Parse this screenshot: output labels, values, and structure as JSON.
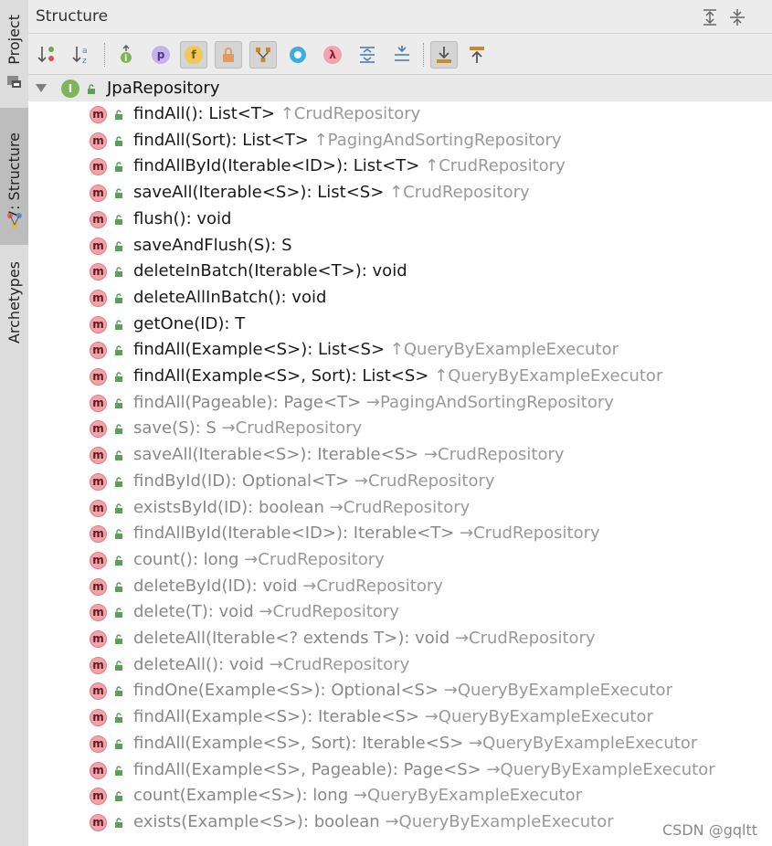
{
  "left_strip": {
    "tabs": [
      {
        "label": "Project"
      },
      {
        "label": "7: Structure"
      },
      {
        "label": "Archetypes"
      }
    ]
  },
  "panel": {
    "title": "Structure",
    "title_icons": [
      "expand-all-icon",
      "collapse-all-icon"
    ],
    "toolbar": [
      {
        "name": "sort-by-visibility-icon",
        "glyph": "↓",
        "color": "#c0392b"
      },
      {
        "name": "sort-alphabetically-icon",
        "glyph": "↓",
        "color": "#5b7ea8"
      },
      {
        "name": "show-inherited-icon",
        "glyph": "i",
        "color": "#6aa84f"
      },
      {
        "name": "show-properties-icon",
        "glyph": "p",
        "color": "#a78bd6"
      },
      {
        "name": "show-fields-icon",
        "glyph": "f",
        "color": "#e8b23a",
        "pressed": true
      },
      {
        "name": "show-non-public-icon",
        "glyph": "🔒",
        "color": "#e08a3c",
        "pressed": true
      },
      {
        "name": "show-hierarchy-icon",
        "glyph": "Y",
        "color": "#c98a2b",
        "pressed": true
      },
      {
        "name": "show-anonymous-icon",
        "glyph": "○",
        "color": "#3aaee0"
      },
      {
        "name": "show-lambdas-icon",
        "glyph": "λ",
        "color": "#e15a77"
      },
      {
        "name": "expand-icon",
        "glyph": "⇕",
        "color": "#5b8bb0"
      },
      {
        "name": "collapse-icon",
        "glyph": "⇳",
        "color": "#5b8bb0"
      },
      {
        "name": "autoscroll-to-source-icon",
        "glyph": "↓",
        "color": "#c98a2b",
        "pressed": true
      },
      {
        "name": "autoscroll-from-source-icon",
        "glyph": "↑",
        "color": "#c98a2b"
      }
    ]
  },
  "tree": {
    "root": {
      "label": "JpaRepository",
      "icon_letter": "I"
    },
    "method_icon_letter": "m",
    "items": [
      {
        "sig": "findAll(): List<T>",
        "inh": "↑CrudRepository",
        "dim": false
      },
      {
        "sig": "findAll(Sort): List<T>",
        "inh": "↑PagingAndSortingRepository",
        "dim": false
      },
      {
        "sig": "findAllById(Iterable<ID>): List<T>",
        "inh": "↑CrudRepository",
        "dim": false
      },
      {
        "sig": "saveAll(Iterable<S>): List<S>",
        "inh": "↑CrudRepository",
        "dim": false
      },
      {
        "sig": "flush(): void",
        "inh": "",
        "dim": false
      },
      {
        "sig": "saveAndFlush(S): S",
        "inh": "",
        "dim": false
      },
      {
        "sig": "deleteInBatch(Iterable<T>): void",
        "inh": "",
        "dim": false
      },
      {
        "sig": "deleteAllInBatch(): void",
        "inh": "",
        "dim": false
      },
      {
        "sig": "getOne(ID): T",
        "inh": "",
        "dim": false
      },
      {
        "sig": "findAll(Example<S>): List<S>",
        "inh": "↑QueryByExampleExecutor",
        "dim": false
      },
      {
        "sig": "findAll(Example<S>, Sort): List<S>",
        "inh": "↑QueryByExampleExecutor",
        "dim": false
      },
      {
        "sig": "findAll(Pageable): Page<T>",
        "inh": "→PagingAndSortingRepository",
        "dim": true
      },
      {
        "sig": "save(S): S",
        "inh": "→CrudRepository",
        "dim": true
      },
      {
        "sig": "saveAll(Iterable<S>): Iterable<S>",
        "inh": "→CrudRepository",
        "dim": true
      },
      {
        "sig": "findById(ID): Optional<T>",
        "inh": "→CrudRepository",
        "dim": true
      },
      {
        "sig": "existsById(ID): boolean",
        "inh": "→CrudRepository",
        "dim": true
      },
      {
        "sig": "findAllById(Iterable<ID>): Iterable<T>",
        "inh": "→CrudRepository",
        "dim": true
      },
      {
        "sig": "count(): long",
        "inh": "→CrudRepository",
        "dim": true
      },
      {
        "sig": "deleteById(ID): void",
        "inh": "→CrudRepository",
        "dim": true
      },
      {
        "sig": "delete(T): void",
        "inh": "→CrudRepository",
        "dim": true
      },
      {
        "sig": "deleteAll(Iterable<? extends T>): void",
        "inh": "→CrudRepository",
        "dim": true
      },
      {
        "sig": "deleteAll(): void",
        "inh": "→CrudRepository",
        "dim": true
      },
      {
        "sig": "findOne(Example<S>): Optional<S>",
        "inh": "→QueryByExampleExecutor",
        "dim": true
      },
      {
        "sig": "findAll(Example<S>): Iterable<S>",
        "inh": "→QueryByExampleExecutor",
        "dim": true
      },
      {
        "sig": "findAll(Example<S>, Sort): Iterable<S>",
        "inh": "→QueryByExampleExecutor",
        "dim": true
      },
      {
        "sig": "findAll(Example<S>, Pageable): Page<S>",
        "inh": "→QueryByExampleExecutor",
        "dim": true
      },
      {
        "sig": "count(Example<S>): long",
        "inh": "→QueryByExampleExecutor",
        "dim": true
      },
      {
        "sig": "exists(Example<S>): boolean",
        "inh": "→QueryByExampleExecutor",
        "dim": true
      }
    ]
  },
  "watermark": "CSDN @gqltt"
}
